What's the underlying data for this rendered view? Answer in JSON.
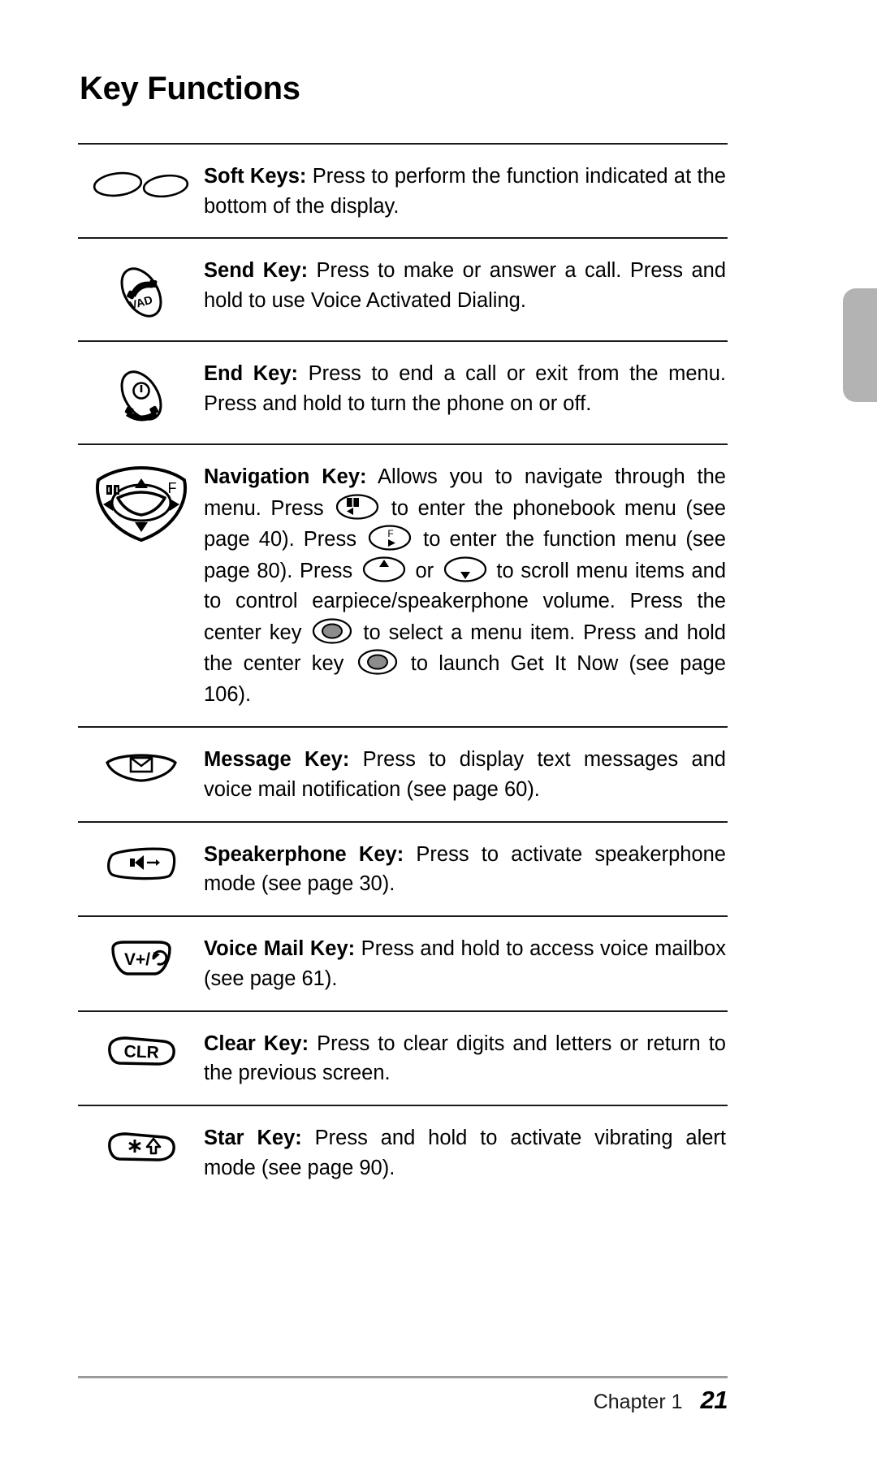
{
  "page": {
    "title": "Key Functions",
    "footer": {
      "chapter": "Chapter 1",
      "page_number": "21"
    },
    "tab_color": "#b3b3b3"
  },
  "rows": [
    {
      "icon": "soft-keys-icon",
      "lead": "Soft Keys:",
      "text": " Press to perform the function indicated at the bottom of the display."
    },
    {
      "icon": "send-key-icon",
      "icon_label": "VAD",
      "lead": "Send Key:",
      "text": " Press to make or answer a call. Press and hold to use Voice Activated Dialing."
    },
    {
      "icon": "end-key-icon",
      "lead": "End Key:",
      "text": " Press to end a call or exit from the menu. Press and hold to turn the phone on or off."
    },
    {
      "icon": "navigation-key-icon",
      "lead": "Navigation Key:",
      "segments": {
        "s1": " Allows you to navigate through the menu. Press ",
        "s2": " to enter the phonebook menu (see page 40). Press ",
        "s3": " to enter the function menu (see page 80). Press ",
        "s4": " or ",
        "s5": " to scroll menu items and to control earpiece/speakerphone volume. Press the center key ",
        "s6": " to select a menu item. Press and hold the center key ",
        "s7": " to launch Get It Now (see page 106)."
      },
      "inline_icons": {
        "phonebook": "phonebook-key-glyph",
        "function": "function-key-glyph",
        "scroll_up": "scroll-up-key-glyph",
        "scroll_down": "scroll-down-key-glyph",
        "center_select": "center-key-glyph",
        "center_hold": "center-key-glyph"
      },
      "function_label": "F"
    },
    {
      "icon": "message-key-icon",
      "lead": "Message Key:",
      "text": " Press to display text messages and voice mail notification (see page 60)."
    },
    {
      "icon": "speakerphone-key-icon",
      "lead": "Speakerphone Key:",
      "text": " Press to activate speakerphone mode (see page 30)."
    },
    {
      "icon": "voice-mail-key-icon",
      "icon_label": "V+/",
      "lead": "Voice Mail Key:",
      "text": " Press and hold to access voice mailbox (see page 61)."
    },
    {
      "icon": "clear-key-icon",
      "icon_label": "CLR",
      "lead": "Clear Key:",
      "text": " Press to clear digits and letters or return to the previous screen."
    },
    {
      "icon": "star-key-icon",
      "lead": "Star Key:",
      "text": " Press and hold to activate vibrating alert mode (see page 90)."
    }
  ]
}
